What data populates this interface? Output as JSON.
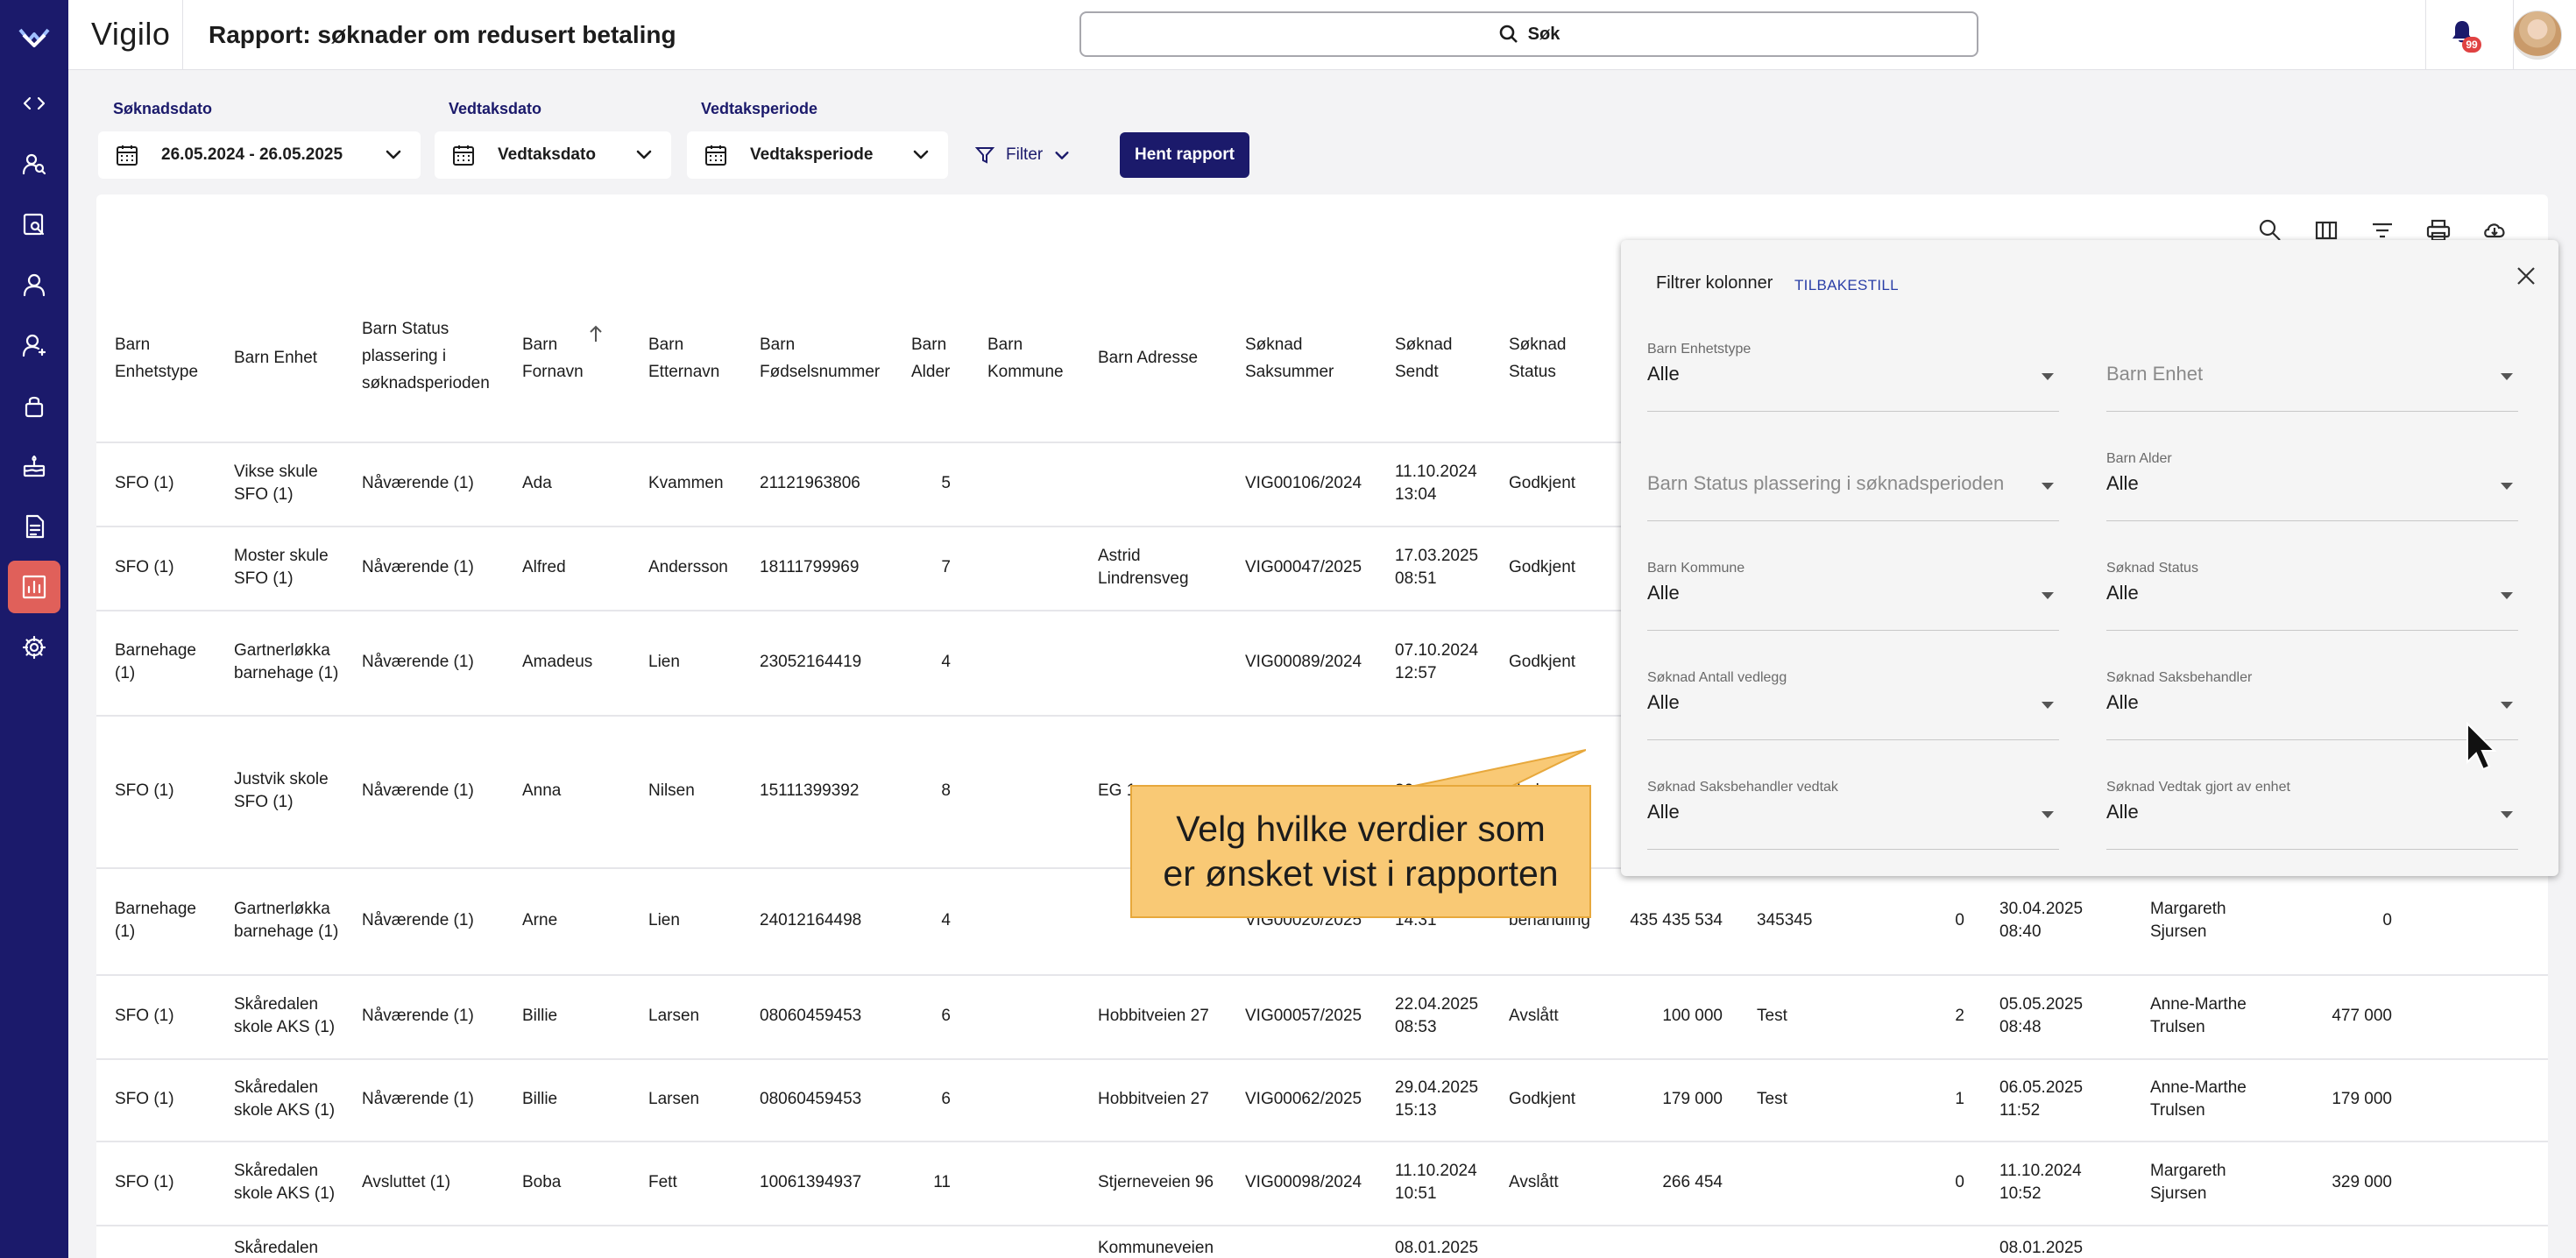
{
  "app": {
    "brand": "Vigilo",
    "title": "Rapport: søknader om redusert betaling",
    "search_label": "Søk",
    "notification_count": "99"
  },
  "nav_icons": [
    "code-icon",
    "people-search-icon",
    "report-search-icon",
    "person-icon",
    "person-manage-icon",
    "lock-icon",
    "cake-icon",
    "document-icon",
    "bar-chart-icon",
    "gear-icon"
  ],
  "filters": {
    "soknadsdato_label": "Søknadsdato",
    "soknadsdato_value": "26.05.2024 - 26.05.2025",
    "vedtaksdato_label": "Vedtaksdato",
    "vedtaksdato_value": "Vedtaksdato",
    "vedtaksperiode_label": "Vedtaksperiode",
    "vedtaksperiode_value": "Vedtaksperiode",
    "filter_label": "Filter",
    "fetch_button": "Hent rapport"
  },
  "table": {
    "headers": [
      "Barn Enhetstype",
      "Barn Enhet",
      "Barn Status plassering i søknadsperioden",
      "Barn Fornavn",
      "Barn Etternavn",
      "Barn Fødselsnummer",
      "Barn Alder",
      "Barn Kommune",
      "Barn Adresse",
      "Søknad Saksummer",
      "Søknad Sendt",
      "Søknad Status"
    ],
    "rows": [
      {
        "enhetstype": "SFO (1)",
        "enhet": "Vikse skule SFO (1)",
        "status": "Nåværende (1)",
        "fornavn": "Ada",
        "etternavn": "Kvammen",
        "fnr": "21121963806",
        "alder": "5",
        "kommune": "",
        "adresse": "",
        "saksnr": "VIG00106/2024",
        "sendt": "11.10.2024 13:04",
        "sstatus": "Godkjent",
        "c13": "",
        "c14": "",
        "c15": "",
        "c16": "",
        "c17": "",
        "c18": ""
      },
      {
        "enhetstype": "SFO (1)",
        "enhet": "Moster skule SFO (1)",
        "status": "Nåværende (1)",
        "fornavn": "Alfred",
        "etternavn": "Andersson",
        "fnr": "18111799969",
        "alder": "7",
        "kommune": "",
        "adresse": "Astrid Lindrensveg",
        "saksnr": "VIG00047/2025",
        "sendt": "17.03.2025 08:51",
        "sstatus": "Godkjent",
        "c13": "",
        "c14": "",
        "c15": "",
        "c16": "",
        "c17": "",
        "c18": ""
      },
      {
        "enhetstype": "Barnehage (1)",
        "enhet": "Gartnerløkka barnehage (1)",
        "status": "Nåværende (1)",
        "fornavn": "Amadeus",
        "etternavn": "Lien",
        "fnr": "23052164419",
        "alder": "4",
        "kommune": "",
        "adresse": "",
        "saksnr": "VIG00089/2024",
        "sendt": "07.10.2024 12:57",
        "sstatus": "Godkjent",
        "c13": "",
        "c14": "",
        "c15": "",
        "c16": "",
        "c17": "",
        "c18": ""
      },
      {
        "enhetstype": "SFO (1)",
        "enhet": "Justvik skole SFO (1)",
        "status": "Nåværende (1)",
        "fornavn": "Anna",
        "etternavn": "Nilsen",
        "fnr": "15111399392",
        "alder": "8",
        "kommune": "",
        "adresse": "EG 1",
        "saksnr": "",
        "sendt": "30.04.",
        "sstatus": "Under",
        "c13": "",
        "c14": "",
        "c15": "",
        "c16": "",
        "c17": "",
        "c18": ""
      },
      {
        "enhetstype": "Barnehage (1)",
        "enhet": "Gartnerløkka barnehage (1)",
        "status": "Nåværende (1)",
        "fornavn": "Arne",
        "etternavn": "Lien",
        "fnr": "24012164498",
        "alder": "4",
        "kommune": "",
        "adresse": "",
        "saksnr": "VIG00020/2025",
        "sendt": "14:31",
        "sstatus": "behandling",
        "c13": "435 435 534",
        "c14": "345345",
        "c15": "0",
        "c16": "30.04.2025 08:40",
        "c17": "Margareth Sjursen",
        "c18": "0"
      },
      {
        "enhetstype": "SFO (1)",
        "enhet": "Skåredalen skole AKS (1)",
        "status": "Nåværende (1)",
        "fornavn": "Billie",
        "etternavn": "Larsen",
        "fnr": "08060459453",
        "alder": "6",
        "kommune": "",
        "adresse": "Hobbitveien 27",
        "saksnr": "VIG00057/2025",
        "sendt": "22.04.2025 08:53",
        "sstatus": "Avslått",
        "c13": "100 000",
        "c14": "Test",
        "c15": "2",
        "c16": "05.05.2025 08:48",
        "c17": "Anne-Marthe Trulsen",
        "c18": "477 000"
      },
      {
        "enhetstype": "SFO (1)",
        "enhet": "Skåredalen skole AKS (1)",
        "status": "Nåværende (1)",
        "fornavn": "Billie",
        "etternavn": "Larsen",
        "fnr": "08060459453",
        "alder": "6",
        "kommune": "",
        "adresse": "Hobbitveien 27",
        "saksnr": "VIG00062/2025",
        "sendt": "29.04.2025 15:13",
        "sstatus": "Godkjent",
        "c13": "179 000",
        "c14": "Test",
        "c15": "1",
        "c16": "06.05.2025 11:52",
        "c17": "Anne-Marthe Trulsen",
        "c18": "179 000"
      },
      {
        "enhetstype": "SFO (1)",
        "enhet": "Skåredalen skole AKS (1)",
        "status": "Avsluttet (1)",
        "fornavn": "Boba",
        "etternavn": "Fett",
        "fnr": "10061394937",
        "alder": "11",
        "kommune": "",
        "adresse": "Stjerneveien 96",
        "saksnr": "VIG00098/2024",
        "sendt": "11.10.2024 10:51",
        "sstatus": "Avslått",
        "c13": "266 454",
        "c14": "",
        "c15": "0",
        "c16": "11.10.2024 10:52",
        "c17": "Margareth Sjursen",
        "c18": "329 000"
      },
      {
        "enhetstype": "",
        "enhet": "Skåredalen",
        "status": "",
        "fornavn": "",
        "etternavn": "",
        "fnr": "",
        "alder": "",
        "kommune": "",
        "adresse": "Kommuneveien",
        "saksnr": "",
        "sendt": "08.01.2025",
        "sstatus": "",
        "c13": "",
        "c14": "",
        "c15": "",
        "c16": "08.01.2025",
        "c17": "",
        "c18": ""
      }
    ]
  },
  "panel": {
    "title": "Filtrer kolonner",
    "reset": "TILBAKESTILL",
    "fields": [
      {
        "label": "Barn Enhetstype",
        "value": "Alle"
      },
      {
        "label": "",
        "value": "Barn Enhet"
      },
      {
        "label": "",
        "value": "Barn Status plassering i søknadsperioden"
      },
      {
        "label": "Barn Alder",
        "value": "Alle"
      },
      {
        "label": "Barn Kommune",
        "value": "Alle"
      },
      {
        "label": "Søknad Status",
        "value": "Alle"
      },
      {
        "label": "Søknad Antall vedlegg",
        "value": "Alle"
      },
      {
        "label": "Søknad Saksbehandler",
        "value": "Alle"
      },
      {
        "label": "Søknad Saksbehandler vedtak",
        "value": "Alle"
      },
      {
        "label": "Søknad Vedtak gjort av enhet",
        "value": "Alle"
      }
    ]
  },
  "callout": {
    "line1": "Velg hvilke verdier som",
    "line2": "er ønsket vist i rapporten"
  },
  "colors": {
    "nav_bg": "#1b1a6b",
    "nav_active": "#e0605a",
    "primary": "#1b1a6b",
    "callout_bg": "#f9c975",
    "badge": "#e04242"
  }
}
